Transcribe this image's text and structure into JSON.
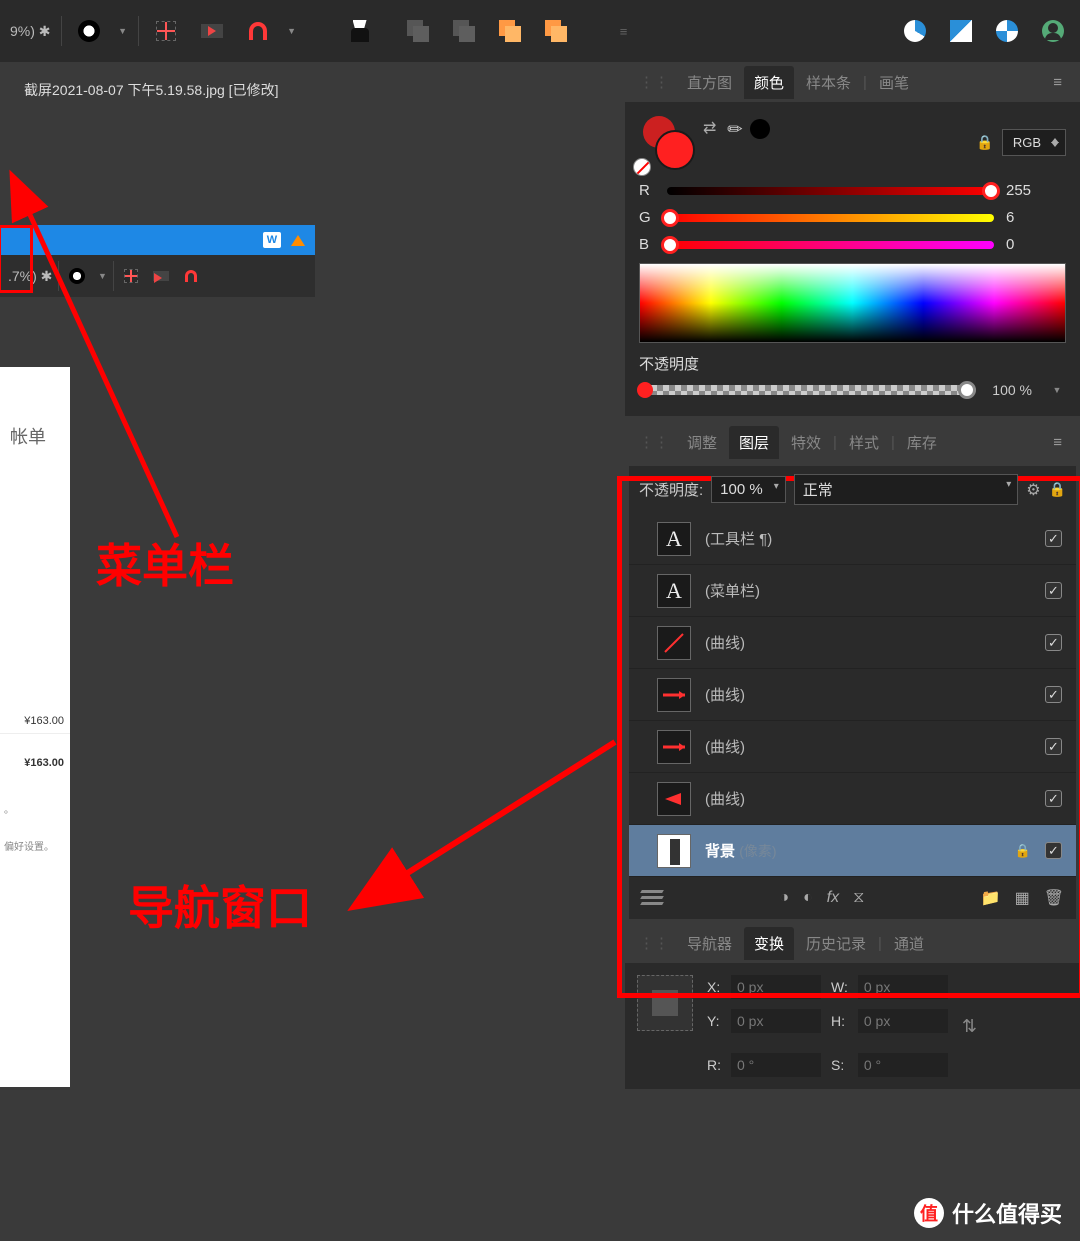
{
  "toolbar": {
    "zoom": "9%) ✱"
  },
  "doc_tab": "截屏2021-08-07 下午5.19.58.jpg [已修改]",
  "inner_zoom": ".7%) ✱",
  "inner_doc": {
    "title": "帐单",
    "price1": "¥163.00",
    "price2": "¥163.00",
    "note1": "。",
    "note2": "偏好设置。"
  },
  "annot1": "菜单栏",
  "annot2": "导航窗口",
  "color_tabs": {
    "a": "直方图",
    "b": "颜色",
    "c": "样本条",
    "d": "画笔"
  },
  "color": {
    "mode": "RGB",
    "r_lab": "R",
    "g_lab": "G",
    "b_lab": "B",
    "r": "255",
    "g": "6",
    "b": "0",
    "opa_lab": "不透明度",
    "opa_val": "100 %"
  },
  "layer_tabs": {
    "a": "调整",
    "b": "图层",
    "c": "特效",
    "d": "样式",
    "e": "库存"
  },
  "layer_head": {
    "opa_lab": "不透明度:",
    "opa_val": "100 %",
    "blend": "正常"
  },
  "layers": [
    {
      "name": "(工具栏 ¶)",
      "thumb": "A"
    },
    {
      "name": "(菜单栏)",
      "thumb": "A"
    },
    {
      "name": "(曲线)",
      "thumb": "line-diag"
    },
    {
      "name": "(曲线)",
      "thumb": "line-h"
    },
    {
      "name": "(曲线)",
      "thumb": "line-h"
    },
    {
      "name": "(曲线)",
      "thumb": "tri"
    },
    {
      "name": "背景",
      "sub": "(像素)",
      "thumb": "bg",
      "sel": true,
      "lock": true
    }
  ],
  "nav_tabs": {
    "a": "导航器",
    "b": "变换",
    "c": "历史记录",
    "d": "通道"
  },
  "trans": {
    "x_lab": "X:",
    "x": "0 px",
    "y_lab": "Y:",
    "y": "0 px",
    "w_lab": "W:",
    "w": "0 px",
    "h_lab": "H:",
    "h": "0 px",
    "r_lab": "R:",
    "r": "0 °",
    "s_lab": "S:",
    "s": "0 °"
  },
  "watermark": {
    "logo": "值",
    "text": "什么值得买"
  }
}
